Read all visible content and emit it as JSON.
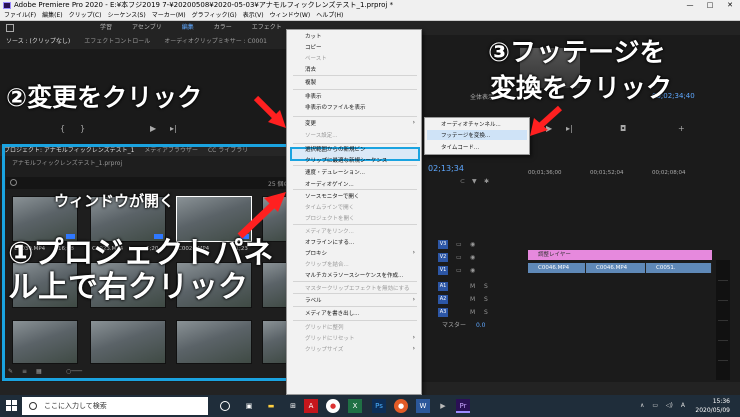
{
  "window": {
    "title": "Adobe Premiere Pro 2020 - E:¥本フジ2019 7-¥20200508¥2020-05-03¥アナモルフィックレンズテスト_1.prproj *",
    "controls": [
      "—",
      "□",
      "✕"
    ]
  },
  "menubar": [
    "ファイル(F)",
    "編集(E)",
    "クリップ(C)",
    "シーケンス(S)",
    "マーカー(M)",
    "グラフィック(G)",
    "表示(V)",
    "ウィンドウ(W)",
    "ヘルプ(H)"
  ],
  "workspace": {
    "tabs": [
      "学習",
      "アセンブリ",
      "編集",
      "カラー",
      "エフェクト"
    ],
    "active": "編集"
  },
  "source_panel": {
    "tabs": [
      "ソース : (クリップなし)",
      "エフェクトコントロール",
      "オーディオクリップミキサー : C0001"
    ]
  },
  "program_panel": {
    "fit_label": "全体表示",
    "timecode": "00;02;34;40"
  },
  "project_panel": {
    "tabs": [
      "プロジェクト: アナモルフィックレンズテスト_1",
      "メディアブラウザー",
      "CC ライブラリ"
    ],
    "file": "アナモルフィックレンズテスト_1.prproj",
    "item_count": "25 個の項目",
    "clips": [
      {
        "name": "C0030.MP4",
        "duration": "16;08"
      },
      {
        "name": "C0023.MP4",
        "duration": "6;20"
      },
      {
        "name": "C0026.MP4",
        "duration": "41;23"
      }
    ]
  },
  "timeline": {
    "timecode": "02;13;34",
    "ruler": [
      "00;01;36;00",
      "00;01;52;04",
      "00;02;08;04"
    ],
    "video_tracks": [
      "V3",
      "V2",
      "V1"
    ],
    "audio_tracks": [
      "A1",
      "A2",
      "A3"
    ],
    "master_label": "マスター",
    "master_value": "0.0",
    "adjustment_clip": "調整レイヤー",
    "video_clips": [
      "C0046.MP4",
      "C0046.MP4",
      "C0051."
    ]
  },
  "context_menu": {
    "items": [
      {
        "label": "カット",
        "disabled": false
      },
      {
        "label": "コピー",
        "disabled": false
      },
      {
        "label": "ペースト",
        "disabled": true
      },
      {
        "label": "消去",
        "disabled": false
      },
      {
        "label": "複製",
        "disabled": false
      },
      {
        "label": "非表示",
        "disabled": false
      },
      {
        "label": "非表示のファイルを表示",
        "disabled": false
      },
      {
        "label": "変更",
        "disabled": false,
        "submenu": true
      },
      {
        "label": "ソース設定...",
        "disabled": true
      },
      {
        "label": "選択範囲からの新規ビン",
        "disabled": false
      },
      {
        "label": "クリップに最適な新規シーケンス",
        "disabled": false
      },
      {
        "label": "速度・デュレーション...",
        "disabled": false
      },
      {
        "label": "オーディオゲイン...",
        "disabled": false
      },
      {
        "label": "ソースモニターで開く",
        "disabled": false
      },
      {
        "label": "タイムラインで開く",
        "disabled": true
      },
      {
        "label": "プロジェクトを開く",
        "disabled": true
      },
      {
        "label": "メディアをリンク...",
        "disabled": true
      },
      {
        "label": "オフラインにする...",
        "disabled": false
      },
      {
        "label": "プロキシ",
        "disabled": false,
        "submenu": true
      },
      {
        "label": "クリップを結合...",
        "disabled": true
      },
      {
        "label": "マルチカメラソースシーケンスを作成...",
        "disabled": false
      },
      {
        "label": "マスタークリップエフェクトを無効にする",
        "disabled": true
      },
      {
        "label": "ラベル",
        "disabled": false,
        "submenu": true
      },
      {
        "label": "メディアを書き出し...",
        "disabled": false
      },
      {
        "label": "グリッドに整列",
        "disabled": true
      },
      {
        "label": "グリッドにリセット",
        "disabled": true,
        "submenu": true
      },
      {
        "label": "クリップサイズ",
        "disabled": true,
        "submenu": true
      }
    ],
    "submenu_items": [
      "オーディオチャンネル...",
      "フッテージを変換...",
      "タイムコード..."
    ],
    "submenu_arrow": "›"
  },
  "annotations": {
    "step2": "②変更をクリック",
    "step3_line1": "③フッテージを",
    "step3_line2": "変換をクリック",
    "window_opens": "ウィンドウが開く",
    "step1_line1": "①プロジェクトパネ",
    "step1_line2": "ル上で右クリック",
    "highlight_color": "#1aa3e0",
    "arrow_color": "#ff2020"
  },
  "taskbar": {
    "search_placeholder": "ここに入力して検索",
    "time": "15:36",
    "date": "2020/05/09",
    "tray_lang": "A"
  }
}
